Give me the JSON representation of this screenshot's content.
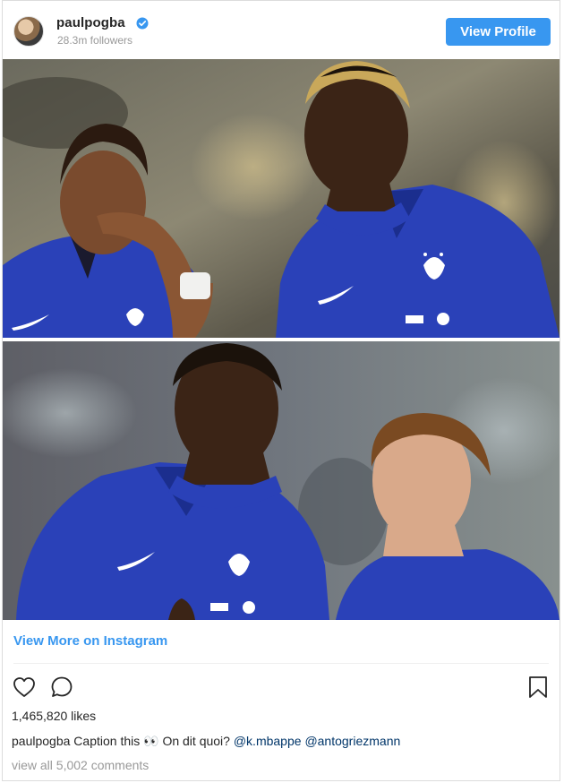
{
  "post": {
    "username": "paulpogba",
    "followers": "28.3m followers",
    "view_profile_label": "View Profile",
    "view_more_label": "View More on Instagram",
    "likes": "1,465,820 likes",
    "caption": {
      "user": "paulpogba",
      "text_before": "Caption this",
      "emoji": "👀",
      "text_after": "On dit quoi?",
      "mention_1": "@k.mbappe",
      "mention_2": "@antogriezmann"
    },
    "comments_label": "view all 5,002 comments"
  },
  "colors": {
    "accent": "#3897f0",
    "jersey": "#2a41b8",
    "verified": "#3897f0",
    "mention": "#003569"
  },
  "icons": {
    "verified": "verified-badge-icon",
    "like": "heart-icon",
    "comment": "comment-bubble-icon",
    "save": "bookmark-icon"
  }
}
